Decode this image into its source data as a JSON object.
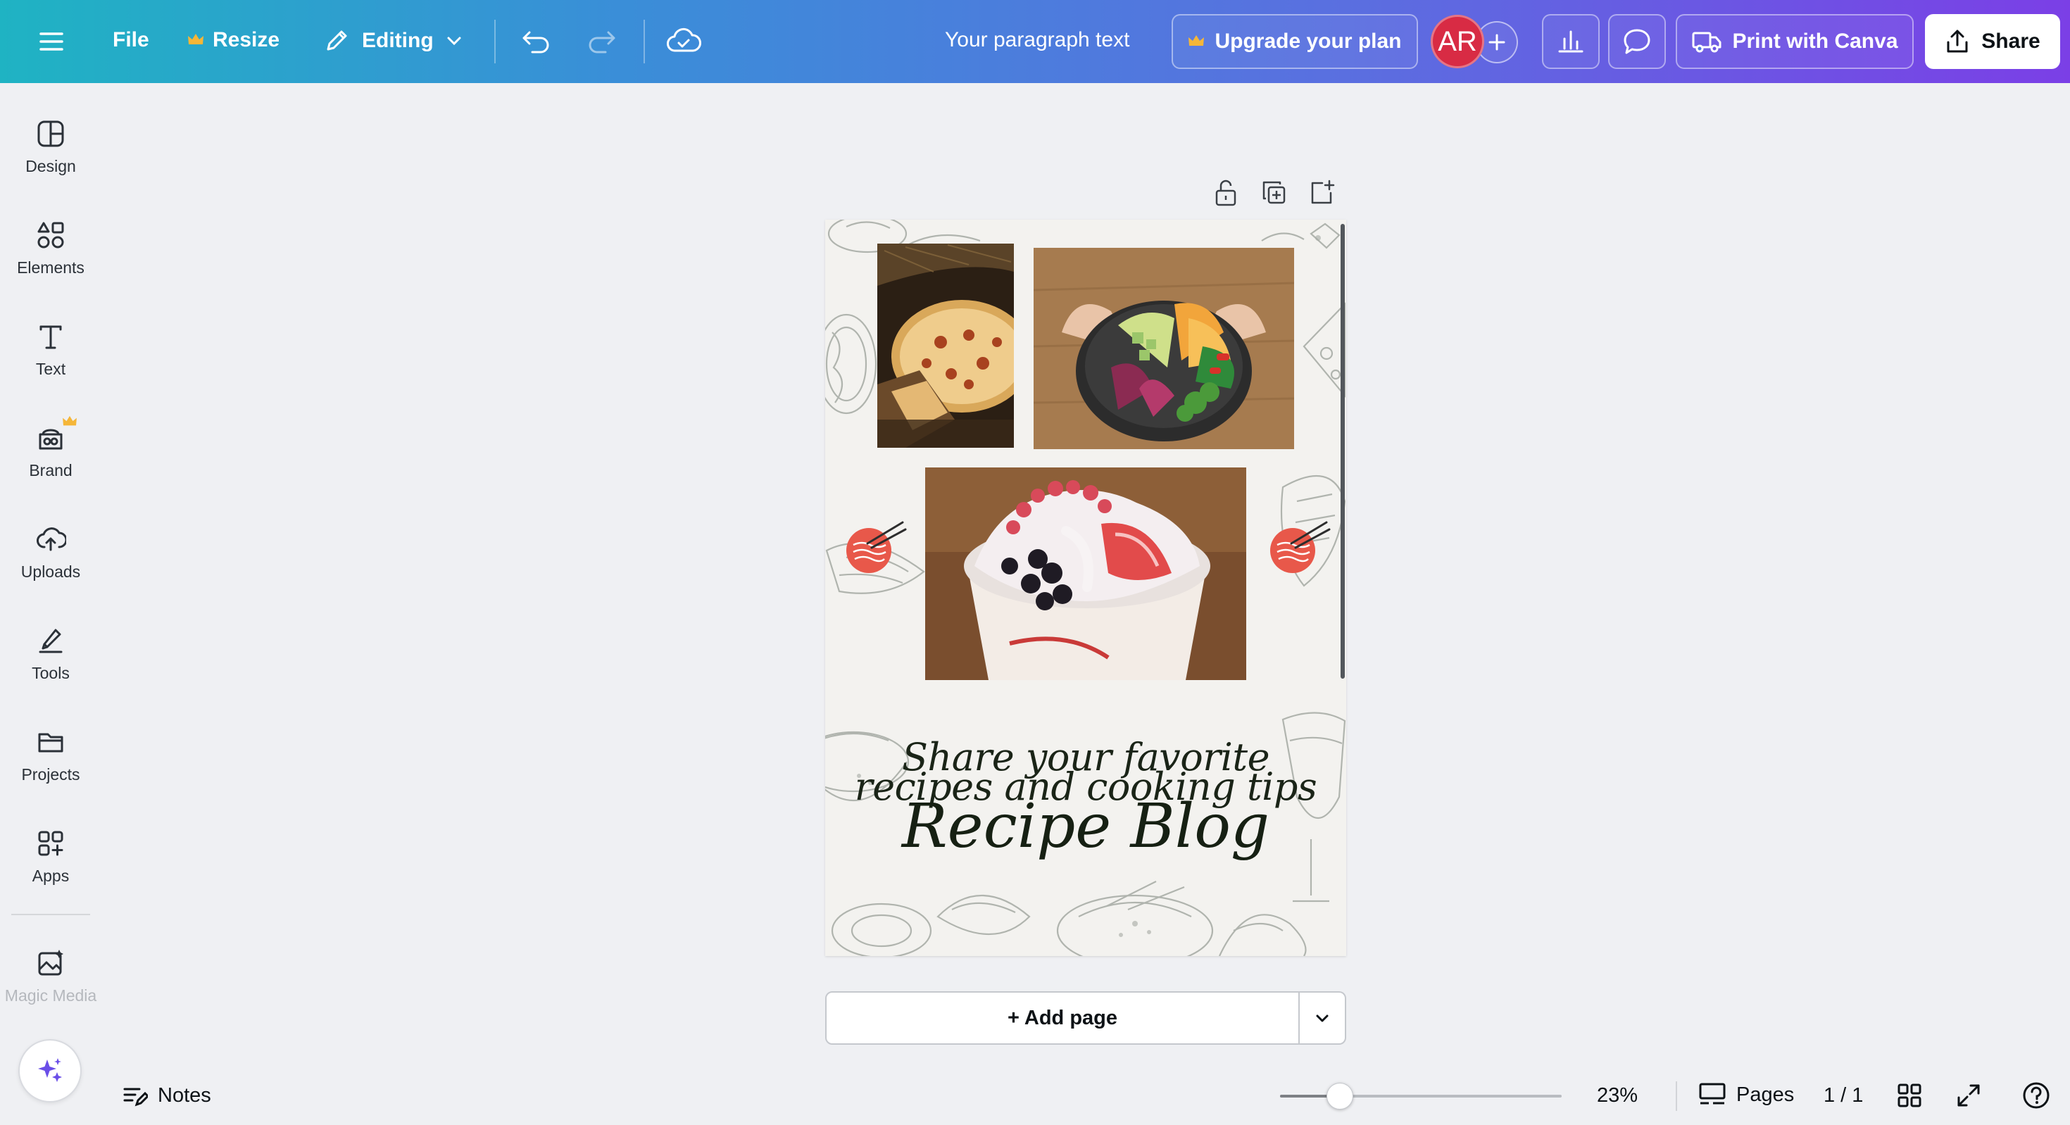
{
  "topbar": {
    "menu_icon": "hamburger-menu-icon",
    "file_label": "File",
    "resize_label": "Resize",
    "editing_label": "Editing",
    "doc_title": "Your paragraph text",
    "upgrade_label": "Upgrade your plan",
    "avatar_initials": "AR",
    "print_label": "Print with Canva",
    "share_label": "Share",
    "colors": {
      "gradient_start": "#1fb3c3",
      "gradient_end": "#7b3fe6",
      "avatar": "#d82b44",
      "crown": "#f5b638"
    }
  },
  "sidebar": {
    "items": [
      {
        "label": "Design",
        "icon": "design-icon"
      },
      {
        "label": "Elements",
        "icon": "elements-icon"
      },
      {
        "label": "Text",
        "icon": "text-icon"
      },
      {
        "label": "Brand",
        "icon": "brand-icon"
      },
      {
        "label": "Uploads",
        "icon": "uploads-icon"
      },
      {
        "label": "Tools",
        "icon": "tools-icon"
      },
      {
        "label": "Projects",
        "icon": "projects-icon"
      },
      {
        "label": "Apps",
        "icon": "apps-icon"
      },
      {
        "label": "Magic Media",
        "icon": "magic-media-icon"
      }
    ]
  },
  "canvas": {
    "images": [
      {
        "name": "pizza-photo"
      },
      {
        "name": "salad-bowl-photo"
      },
      {
        "name": "berry-yogurt-photo"
      }
    ],
    "tagline_line1": "Share your favorite",
    "tagline_line2": "recipes and cooking tips",
    "title": "Recipe Blog"
  },
  "add_page": {
    "label": "+ Add page"
  },
  "bottombar": {
    "notes_label": "Notes",
    "zoom_percent": "23%",
    "zoom_value": 0.23,
    "pages_label": "Pages",
    "page_count": "1 / 1"
  }
}
